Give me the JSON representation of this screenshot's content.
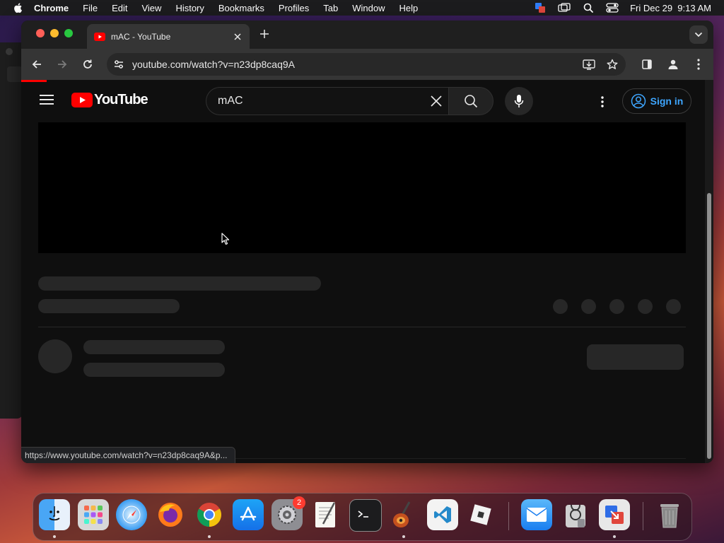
{
  "menubar": {
    "app_name": "Chrome",
    "items": [
      "File",
      "Edit",
      "View",
      "History",
      "Bookmarks",
      "Profiles",
      "Tab",
      "Window",
      "Help"
    ],
    "clock": "Fri Dec 29  9:13 AM"
  },
  "browser": {
    "tab_title": "mAC - YouTube",
    "url": "youtube.com/watch?v=n23dp8caq9A",
    "status_url": "https://www.youtube.com/watch?v=n23dp8caq9A&p..."
  },
  "youtube": {
    "logo_text": "YouTube",
    "search_query": "mAC",
    "signin_label": "Sign in"
  },
  "dock": {
    "apps": [
      "finder",
      "launchpad",
      "safari",
      "firefox",
      "chrome",
      "app-store",
      "system-settings",
      "textedit",
      "terminal",
      "garageband",
      "vscode",
      "roblox",
      "mail",
      "disk-utility",
      "screen-sharing",
      "trash"
    ],
    "settings_badge": "2"
  },
  "colors": {
    "youtube_red": "#ff0000",
    "signin_blue": "#3ea6ff",
    "page_bg": "#0f0f0f"
  }
}
